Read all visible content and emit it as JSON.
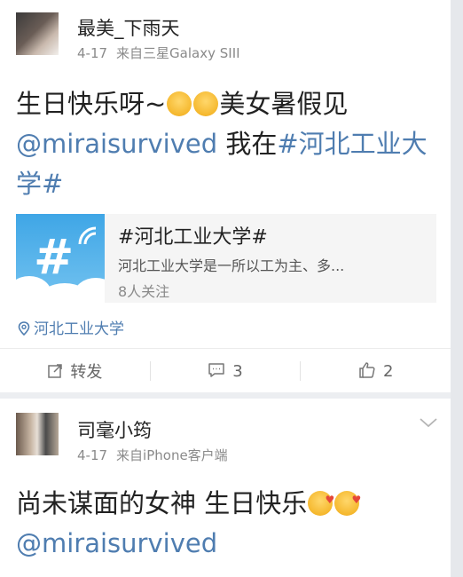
{
  "posts": [
    {
      "username": "最美_下雨天",
      "date": "4-17",
      "source": "来自三星Galaxy SIII",
      "text_part1": "生日快乐呀~",
      "text_part2": "美女暑假见",
      "mention": "@miraisurvived",
      "text_part3": " 我在",
      "hashtag": "#河北工业大学#",
      "topic": {
        "title": "#河北工业大学#",
        "description": "河北工业大学是一所以工为主、多...",
        "followers": "8人关注"
      },
      "location": "河北工业大学",
      "actions": {
        "repost_label": "转发",
        "comment_count": "3",
        "like_count": "2"
      }
    },
    {
      "username": "司毫小筠",
      "date": "4-17",
      "source": "来自iPhone客户端",
      "text_part1": "尚未谋面的女神 生日快乐",
      "mention": "@miraisurvived"
    }
  ],
  "colors": {
    "link": "#4f7db0",
    "meta": "#8a8a8a",
    "background": "#eceef1"
  }
}
